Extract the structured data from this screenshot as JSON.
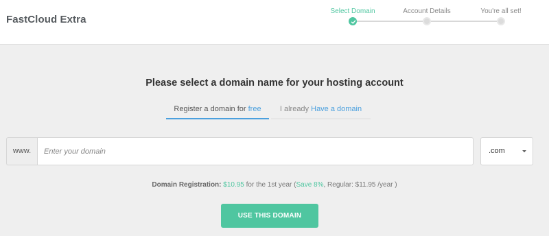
{
  "header": {
    "brand": "FastCloud Extra",
    "steps": [
      {
        "label": "Select Domain",
        "state": "done"
      },
      {
        "label": "Account Details",
        "state": "pending"
      },
      {
        "label": "You're all set!",
        "state": "pending"
      }
    ]
  },
  "main": {
    "title": "Please select a domain name for your hosting account",
    "tabs": [
      {
        "prefix": "Register a domain for",
        "highlight": "free",
        "active": true
      },
      {
        "prefix": "I already",
        "highlight": "Have a domain",
        "active": false
      }
    ],
    "domain": {
      "prefix": "www.",
      "placeholder": "Enter your domain",
      "value": "",
      "tld": ".com"
    },
    "pricing": {
      "label": "Domain Registration:",
      "price": "$10.95",
      "period": "for the 1st year (",
      "save": "Save 8%",
      "regular": ", Regular: $11.95 /year )"
    },
    "submit_label": "USE THIS DOMAIN"
  },
  "colors": {
    "accent_green": "#4fc6a0",
    "accent_blue": "#4ba0de"
  },
  "icons": {
    "step_done": "check-icon",
    "select_caret": "caret-down-icon"
  }
}
